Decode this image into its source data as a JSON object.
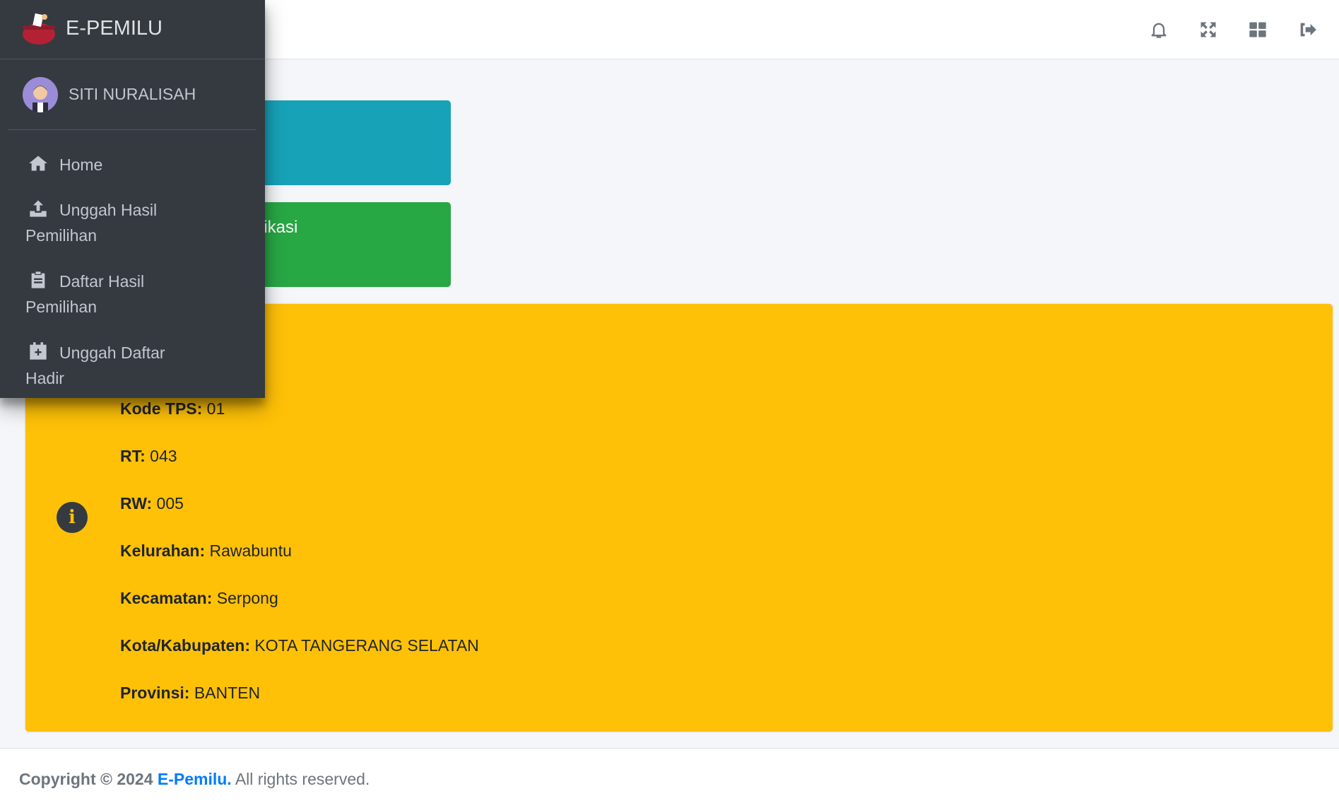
{
  "brand": {
    "name": "E-PEMILU"
  },
  "user": {
    "name": "SITI NURALISAH"
  },
  "menu": {
    "home": "Home",
    "upload_results": {
      "line1": "Unggah Hasil",
      "line2": "Pemilihan"
    },
    "results_list": {
      "line1": "Daftar Hasil",
      "line2": "Pemilihan"
    },
    "upload_attendance": {
      "line1": "Unggah Daftar",
      "line2": "Hadir"
    }
  },
  "navbar": {
    "icons": [
      "bell-icon",
      "fullscreen-icon",
      "apps-grid-icon",
      "logout-icon"
    ]
  },
  "cards": {
    "green_label": "erifikasi"
  },
  "tps_info": {
    "kode_tps": {
      "label": "Kode TPS:",
      "value": "01"
    },
    "rt": {
      "label": "RT:",
      "value": "043"
    },
    "rw": {
      "label": "RW:",
      "value": "005"
    },
    "kelurahan": {
      "label": "Kelurahan:",
      "value": "Rawabuntu"
    },
    "kecamatan": {
      "label": "Kecamatan:",
      "value": "Serpong"
    },
    "kota": {
      "label": "Kota/Kabupaten:",
      "value": "KOTA TANGERANG SELATAN"
    },
    "provinsi": {
      "label": "Provinsi:",
      "value": "BANTEN"
    }
  },
  "footer": {
    "copyright": "Copyright © 2024",
    "brand": "E-Pemilu.",
    "rights": "All rights reserved."
  },
  "colors": {
    "sidebar": "#343a40",
    "teal": "#17a2b8",
    "green": "#28a745",
    "warning": "#ffc107",
    "link": "#007bff"
  }
}
